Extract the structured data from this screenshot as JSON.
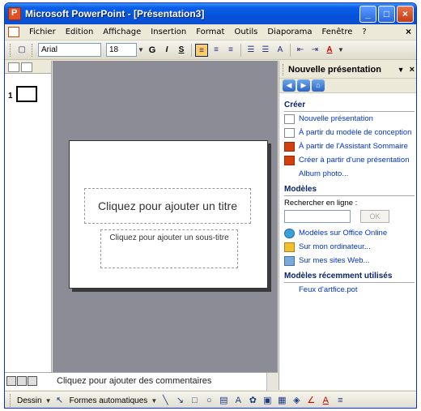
{
  "window": {
    "title": "Microsoft PowerPoint - [Présentation3]"
  },
  "menubar": {
    "items": [
      "Fichier",
      "Edition",
      "Affichage",
      "Insertion",
      "Format",
      "Outils",
      "Diaporama",
      "Fenêtre",
      "?"
    ]
  },
  "toolbar": {
    "font": "Arial",
    "size": "18"
  },
  "outline": {
    "slide_number": "1"
  },
  "slide": {
    "title_placeholder": "Cliquez pour ajouter un titre",
    "subtitle_placeholder": "Cliquez pour ajouter un sous-titre"
  },
  "notes": {
    "placeholder": "Cliquez pour ajouter des commentaires"
  },
  "taskpane": {
    "title": "Nouvelle présentation",
    "create_heading": "Créer",
    "create_links": [
      "Nouvelle présentation",
      "À partir du modèle de conception",
      "À partir de l'Assistant Sommaire",
      "Créer à partir d'une présentation",
      "Album photo..."
    ],
    "models_heading": "Modèles",
    "search_label": "Rechercher en ligne :",
    "ok_label": "OK",
    "model_links": [
      "Modèles sur Office Online",
      "Sur mon ordinateur...",
      "Sur mes sites Web..."
    ],
    "recent_heading": "Modèles récemment utilisés",
    "recent_links": [
      "Feux d'artfice.pot"
    ]
  },
  "drawbar": {
    "draw_label": "Dessin",
    "autoshapes_label": "Formes automatiques"
  },
  "colors": {
    "titlebar": "#0653db",
    "slide_bg": "#8c8c96",
    "link": "#0033cc"
  }
}
